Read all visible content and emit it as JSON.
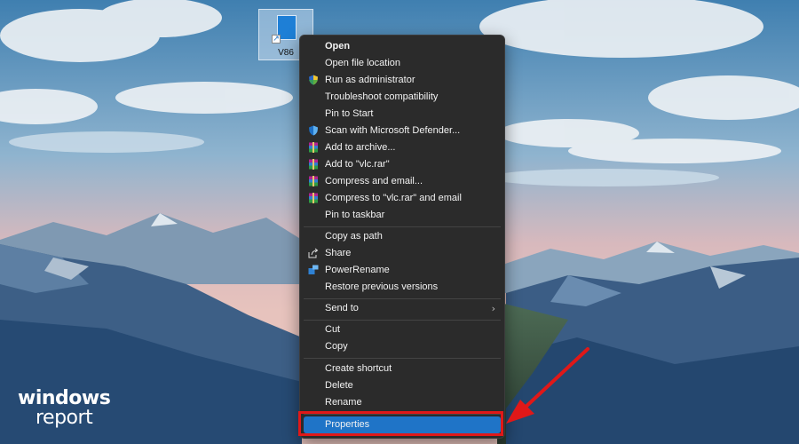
{
  "desktop": {
    "icon_label": "V86"
  },
  "watermark": {
    "line1": "windows",
    "line2": "report"
  },
  "context_menu": {
    "items": [
      {
        "label": "Open",
        "icon": "none"
      },
      {
        "label": "Open file location",
        "icon": "none"
      },
      {
        "label": "Run as administrator",
        "icon": "uac-shield-icon"
      },
      {
        "label": "Troubleshoot compatibility",
        "icon": "none"
      },
      {
        "label": "Pin to Start",
        "icon": "none"
      },
      {
        "label": "Scan with Microsoft Defender...",
        "icon": "defender-icon"
      },
      {
        "label": "Add to archive...",
        "icon": "winrar-icon"
      },
      {
        "label": "Add to \"vlc.rar\"",
        "icon": "winrar-icon"
      },
      {
        "label": "Compress and email...",
        "icon": "winrar-icon"
      },
      {
        "label": "Compress to \"vlc.rar\" and email",
        "icon": "winrar-icon"
      },
      {
        "label": "Pin to taskbar",
        "icon": "none"
      },
      {
        "label": "Copy as path",
        "icon": "none"
      },
      {
        "label": "Share",
        "icon": "share-icon"
      },
      {
        "label": "PowerRename",
        "icon": "powerrename-icon"
      },
      {
        "label": "Restore previous versions",
        "icon": "none"
      },
      {
        "label": "Send to",
        "icon": "chevron-right-icon"
      },
      {
        "label": "Cut",
        "icon": "none"
      },
      {
        "label": "Copy",
        "icon": "none"
      },
      {
        "label": "Create shortcut",
        "icon": "none"
      },
      {
        "label": "Delete",
        "icon": "none"
      },
      {
        "label": "Rename",
        "icon": "none"
      },
      {
        "label": "Properties",
        "icon": "none",
        "selected": true
      }
    ]
  },
  "colors": {
    "menu_bg": "#2b2b2b",
    "selection": "#1f74c7",
    "annotation_red": "#e01818"
  }
}
